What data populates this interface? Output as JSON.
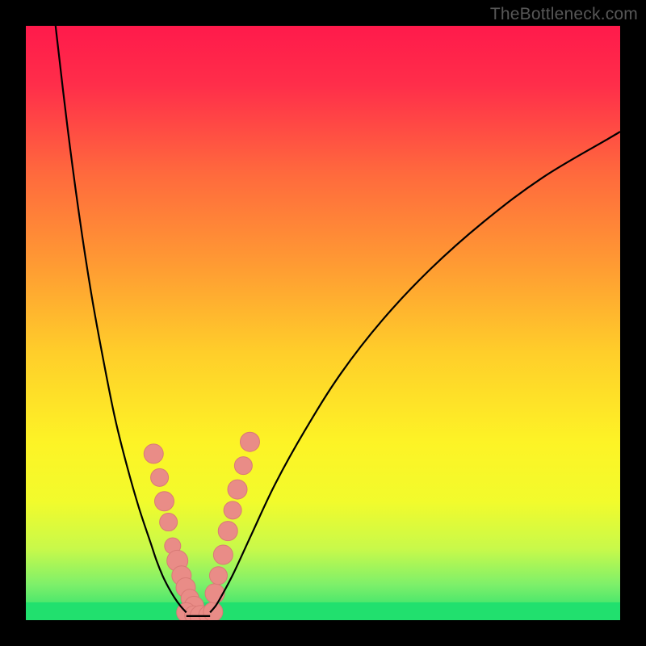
{
  "watermark": "TheBottleneck.com",
  "chart_data": {
    "type": "line",
    "title": "",
    "xlabel": "",
    "ylabel": "",
    "xlim": [
      0,
      100
    ],
    "ylim": [
      0,
      100
    ],
    "grid": false,
    "legend": false,
    "annotations": [],
    "background_gradient": {
      "type": "vertical",
      "stops": [
        {
          "offset": 0.0,
          "color": "#ff1a4b"
        },
        {
          "offset": 0.1,
          "color": "#ff2e4a"
        },
        {
          "offset": 0.25,
          "color": "#ff6a3d"
        },
        {
          "offset": 0.4,
          "color": "#ff9a33"
        },
        {
          "offset": 0.55,
          "color": "#ffce2a"
        },
        {
          "offset": 0.7,
          "color": "#fdf326"
        },
        {
          "offset": 0.8,
          "color": "#f2fb2c"
        },
        {
          "offset": 0.88,
          "color": "#c8f94a"
        },
        {
          "offset": 0.94,
          "color": "#7ef06a"
        },
        {
          "offset": 1.0,
          "color": "#1fdf6e"
        }
      ]
    },
    "bottom_band": {
      "y_from": 97,
      "y_to": 100,
      "color": "#21e06e"
    },
    "series": [
      {
        "name": "left-curve",
        "stroke": "#000000",
        "stroke_width": 2.2,
        "x": [
          5,
          7,
          9,
          11,
          13,
          15,
          17,
          19,
          21,
          22,
          23,
          24,
          25,
          26,
          27
        ],
        "y": [
          0,
          17,
          32,
          45,
          56,
          66,
          74,
          81,
          87,
          90,
          92.5,
          94.5,
          96.2,
          97.6,
          98.7
        ]
      },
      {
        "name": "right-curve",
        "stroke": "#000000",
        "stroke_width": 2.2,
        "x": [
          31,
          32,
          33,
          35,
          38,
          42,
          47,
          53,
          60,
          68,
          77,
          87,
          98,
          100
        ],
        "y": [
          98.7,
          97.5,
          95.8,
          92.0,
          85.5,
          77.0,
          68.0,
          58.5,
          49.5,
          41.0,
          33.0,
          25.5,
          19.0,
          17.8
        ]
      }
    ],
    "flat_minimum": {
      "x": [
        27,
        31
      ],
      "y": 99.3
    },
    "marker_clusters": [
      {
        "name": "left-cluster",
        "fill": "#e98c87",
        "stroke": "#d97a76",
        "points": [
          {
            "x": 21.5,
            "y": 72.0,
            "r": 12
          },
          {
            "x": 22.5,
            "y": 76.0,
            "r": 11
          },
          {
            "x": 23.3,
            "y": 80.0,
            "r": 12
          },
          {
            "x": 24.0,
            "y": 83.5,
            "r": 11
          },
          {
            "x": 24.7,
            "y": 87.5,
            "r": 10
          },
          {
            "x": 25.5,
            "y": 90.0,
            "r": 13
          },
          {
            "x": 26.2,
            "y": 92.5,
            "r": 12
          },
          {
            "x": 26.9,
            "y": 94.5,
            "r": 12
          },
          {
            "x": 27.6,
            "y": 96.3,
            "r": 11
          },
          {
            "x": 28.3,
            "y": 97.6,
            "r": 12
          }
        ]
      },
      {
        "name": "bottom-cluster",
        "fill": "#e98c87",
        "stroke": "#d97a76",
        "points": [
          {
            "x": 27.0,
            "y": 98.7,
            "r": 12
          },
          {
            "x": 28.2,
            "y": 99.1,
            "r": 11
          },
          {
            "x": 29.4,
            "y": 99.3,
            "r": 13
          },
          {
            "x": 30.6,
            "y": 99.1,
            "r": 11
          },
          {
            "x": 31.5,
            "y": 98.6,
            "r": 12
          }
        ]
      },
      {
        "name": "right-cluster",
        "fill": "#e98c87",
        "stroke": "#d97a76",
        "points": [
          {
            "x": 31.8,
            "y": 95.5,
            "r": 12
          },
          {
            "x": 32.4,
            "y": 92.5,
            "r": 11
          },
          {
            "x": 33.2,
            "y": 89.0,
            "r": 12
          },
          {
            "x": 34.0,
            "y": 85.0,
            "r": 12
          },
          {
            "x": 34.8,
            "y": 81.5,
            "r": 11
          },
          {
            "x": 35.6,
            "y": 78.0,
            "r": 12
          },
          {
            "x": 36.6,
            "y": 74.0,
            "r": 11
          },
          {
            "x": 37.7,
            "y": 70.0,
            "r": 12
          }
        ]
      }
    ]
  }
}
